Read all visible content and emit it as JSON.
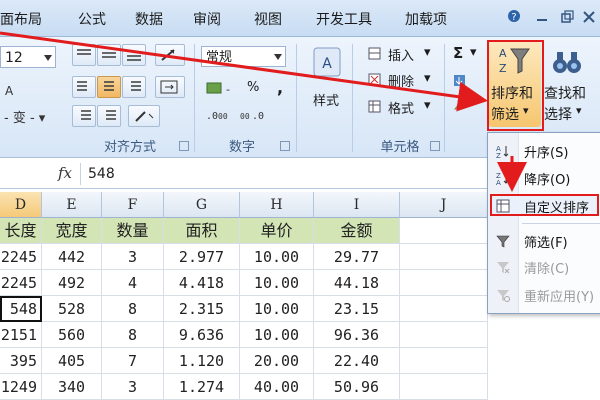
{
  "ribbon_tabs": [
    "面布局",
    "公式",
    "数据",
    "审阅",
    "视图",
    "开发工具",
    "加载项"
  ],
  "font_size": "12",
  "number_format": "常规",
  "number_buttons": {
    "percent": "%",
    "comma": ","
  },
  "cells_group": {
    "insert": "插入",
    "delete": "删除",
    "format": "格式"
  },
  "styles_label": "样式",
  "sort_filter": {
    "line1": "排序和",
    "line2": "筛选"
  },
  "find_select": {
    "line1": "查找和",
    "line2": "选择"
  },
  "groups": {
    "alignment": "对齐方式",
    "number": "数字",
    "cells": "单元格"
  },
  "formula": {
    "fx": "fx",
    "value": "548"
  },
  "columns": [
    "D",
    "E",
    "F",
    "G",
    "H",
    "I",
    "J"
  ],
  "headers": [
    "长度",
    "宽度",
    "数量",
    "面积",
    "单价",
    "金额"
  ],
  "rows": [
    [
      "2245",
      "442",
      "3",
      "2.977",
      "10.00",
      "29.77"
    ],
    [
      "2245",
      "492",
      "4",
      "4.418",
      "10.00",
      "44.18"
    ],
    [
      "548",
      "528",
      "8",
      "2.315",
      "10.00",
      "23.15"
    ],
    [
      "2151",
      "560",
      "8",
      "9.636",
      "10.00",
      "96.36"
    ],
    [
      "395",
      "405",
      "7",
      "1.120",
      "20.00",
      "22.40"
    ],
    [
      "1249",
      "340",
      "3",
      "1.274",
      "40.00",
      "50.96"
    ]
  ],
  "menu": {
    "items": [
      {
        "label": "升序(S)",
        "icon": "sort-ascending-icon",
        "enabled": true
      },
      {
        "label": "降序(O)",
        "icon": "sort-descending-icon",
        "enabled": true
      },
      {
        "label": "自定义排序",
        "icon": "custom-sort-icon",
        "enabled": true
      },
      {
        "label": "筛选(F)",
        "icon": "filter-icon",
        "enabled": true
      },
      {
        "label": "清除(C)",
        "icon": "clear-filter-icon",
        "enabled": false
      },
      {
        "label": "重新应用(Y)",
        "icon": "reapply-icon",
        "enabled": false
      }
    ]
  },
  "colors": {
    "annotation_red": "#e21c1c",
    "header_green": "#d3e4b5",
    "ribbon_blue": "#dce9f8"
  }
}
